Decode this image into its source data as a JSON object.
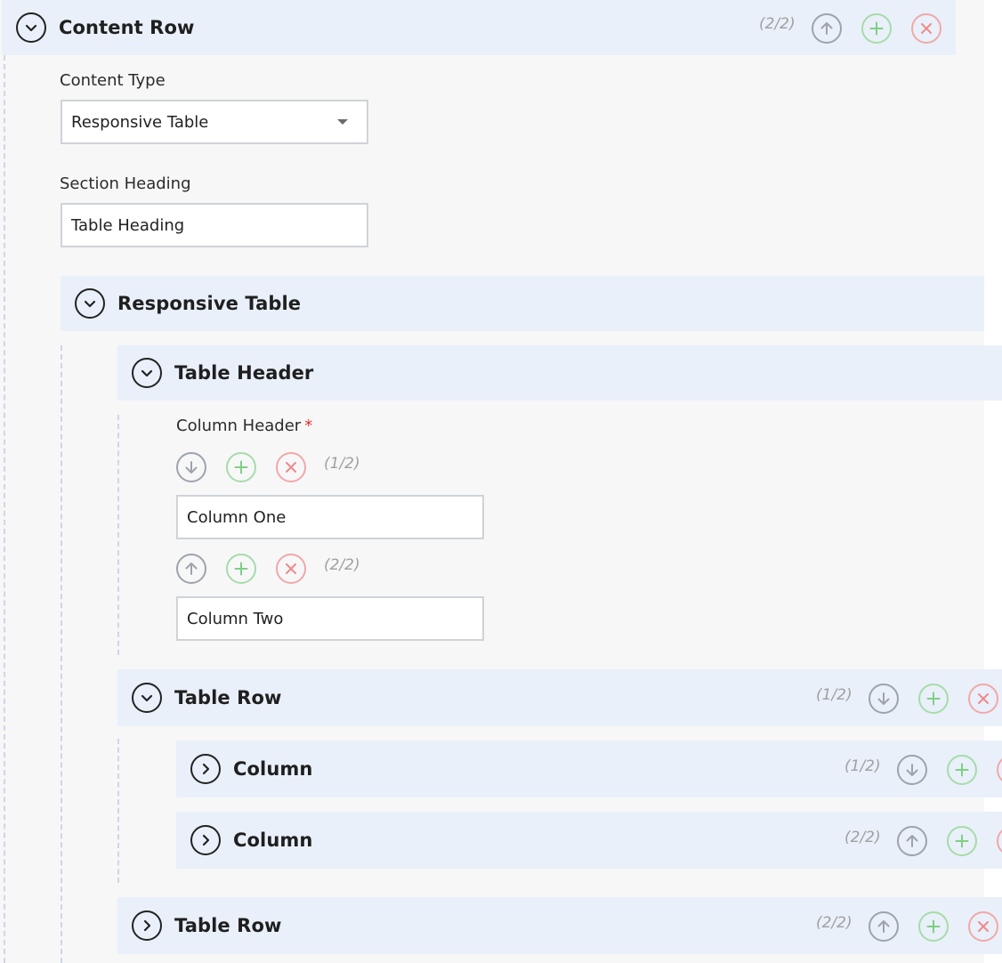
{
  "content_row": {
    "title": "Content Row",
    "counter": "(2/2)"
  },
  "content_type": {
    "label": "Content Type",
    "selected": "Responsive Table"
  },
  "section_heading": {
    "label": "Section Heading",
    "value": "Table Heading"
  },
  "responsive_table": {
    "title": "Responsive Table"
  },
  "table_header": {
    "title": "Table Header",
    "column_header_label": "Column Header",
    "required_mark": "*",
    "items": [
      {
        "counter": "(1/2)",
        "value": "Column One"
      },
      {
        "counter": "(2/2)",
        "value": "Column Two"
      }
    ]
  },
  "table_rows": [
    {
      "title": "Table Row",
      "counter": "(1/2)",
      "columns": [
        {
          "title": "Column",
          "counter": "(1/2)"
        },
        {
          "title": "Column",
          "counter": "(2/2)"
        }
      ]
    },
    {
      "title": "Table Row",
      "counter": "(2/2)"
    }
  ],
  "colors": {
    "bar_background": "#e9f0f9",
    "panel_background": "#f7f7f8",
    "move_icon": "#9ea3ab",
    "add_icon": "#7fcf85",
    "delete_icon": "#ef8a8a",
    "required_mark": "#d9322c"
  },
  "icons": {
    "expanded": "chevron-down-icon",
    "collapsed": "chevron-right-icon",
    "move_up": "arrow-up-icon",
    "move_down": "arrow-down-icon",
    "add": "plus-icon",
    "delete": "close-icon"
  }
}
